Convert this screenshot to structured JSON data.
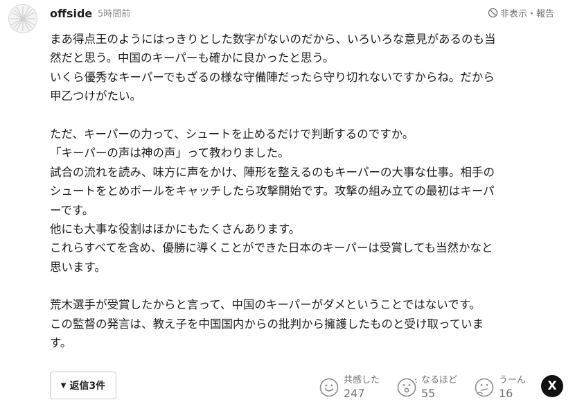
{
  "comment": {
    "author": "offside",
    "time": "5時間前",
    "report_label": "非表示・報告",
    "lines": [
      "まあ得点王のようにはっきりとした数字がないのだから、いろいろな意見があるのも当",
      "然だと思う。中国のキーパーも確かに良かったと思う。",
      "いくら優秀なキーパーでもざるの様な守備陣だったら守り切れないですからね。だから",
      "甲乙つけがたい。",
      "",
      "ただ、キーパーの力って、シュートを止めるだけで判断するのですか。",
      "「キーパーの声は神の声」って教わりました。",
      "試合の流れを読み、味方に声をかけ、陣形を整えるのもキーパーの大事な仕事。相手の",
      "シュートをとめボールをキャッチしたら攻撃開始です。攻撃の組み立ての最初はキーパ",
      "ーです。",
      "他にも大事な役割はほかにもたくさんあります。",
      "これらすべてを含め、優勝に導くことができた日本のキーパーは受賞しても当然かなと",
      "思います。",
      "",
      "荒木選手が受賞したからと言って、中国のキーパーがダメということではないです。",
      "この監督の発言は、教え子を中国国内からの批判から擁護したものと受け取っていま",
      "す。"
    ]
  },
  "replies": {
    "label": "返信3件",
    "icon": "triangle-down-icon"
  },
  "reactions": [
    {
      "label": "共感した",
      "count": "247",
      "icon": "smile-icon"
    },
    {
      "label": "なるほど",
      "count": "55",
      "icon": "surprised-icon"
    },
    {
      "label": "うーん",
      "count": "16",
      "icon": "thinking-icon"
    }
  ],
  "share": {
    "icon": "x-logo-icon",
    "glyph": "X"
  }
}
